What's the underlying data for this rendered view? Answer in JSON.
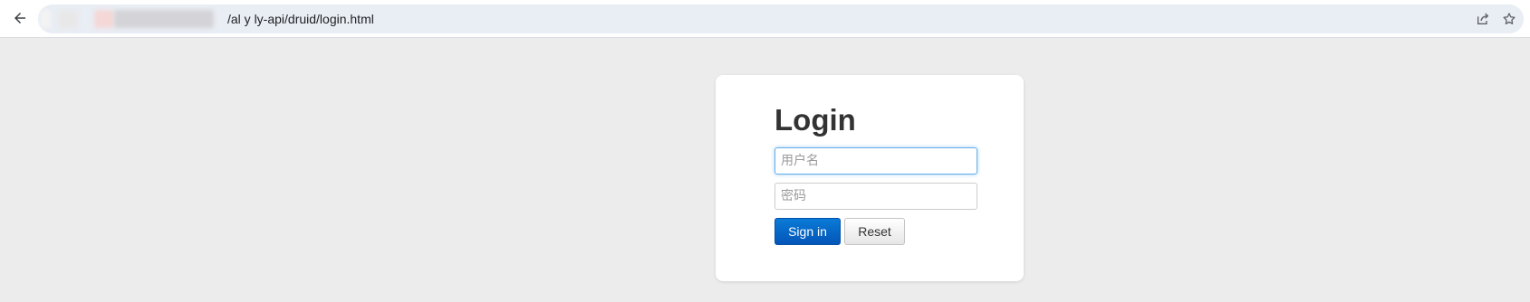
{
  "browser": {
    "url_visible": "/al y  ly-api/druid/login.html",
    "icons": [
      "back-arrow-icon",
      "share-icon",
      "star-icon"
    ]
  },
  "login": {
    "title": "Login",
    "username_placeholder": "用户名",
    "password_placeholder": "密码",
    "signin_label": "Sign in",
    "reset_label": "Reset"
  },
  "colors": {
    "page_bg": "#ececec",
    "primary_button": "#0a6fd0",
    "focus_border": "#66afe9"
  }
}
